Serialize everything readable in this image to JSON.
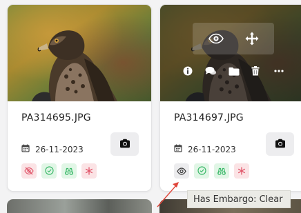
{
  "cards": [
    {
      "filename": "PA314695.JPG",
      "date": "26-11-2023",
      "embargo_state": "active"
    },
    {
      "filename": "PA314697.JPG",
      "date": "26-11-2023",
      "embargo_state": "clear"
    }
  ],
  "tooltip": {
    "text": "Has Embargo: Clear"
  },
  "overlay_icons": [
    "eye-icon",
    "move-icon",
    "info-icon",
    "comment-icon",
    "folder-icon",
    "trash-icon",
    "more-icon"
  ],
  "colors": {
    "embargo_red": "#e0566a",
    "status_green": "#3cb96a",
    "annotation_arrow": "#e0453a"
  }
}
